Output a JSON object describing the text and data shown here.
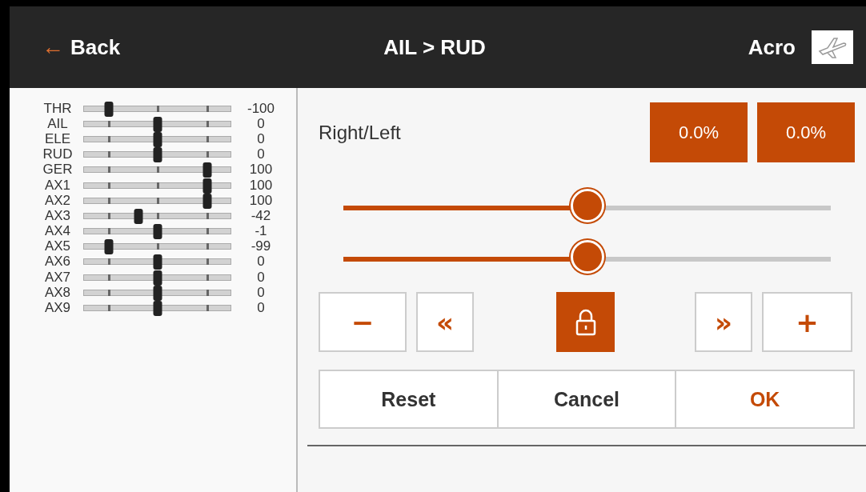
{
  "header": {
    "back": {
      "arrow": "←",
      "label": "Back"
    },
    "title": "AIL > RUD",
    "mode": "Acro"
  },
  "channels": [
    {
      "name": "THR",
      "level": 0.17,
      "reading": "-100"
    },
    {
      "name": "AIL",
      "level": 0.5,
      "reading": "0"
    },
    {
      "name": "ELE",
      "level": 0.5,
      "reading": "0"
    },
    {
      "name": "RUD",
      "level": 0.5,
      "reading": "0"
    },
    {
      "name": "GER",
      "level": 0.84,
      "reading": "100"
    },
    {
      "name": "AX1",
      "level": 0.84,
      "reading": "100"
    },
    {
      "name": "AX2",
      "level": 0.84,
      "reading": "100"
    },
    {
      "name": "AX3",
      "level": 0.37,
      "reading": "-42"
    },
    {
      "name": "AX4",
      "level": 0.5,
      "reading": "-1"
    },
    {
      "name": "AX5",
      "level": 0.17,
      "reading": "-99"
    },
    {
      "name": "AX6",
      "level": 0.5,
      "reading": "0"
    },
    {
      "name": "AX7",
      "level": 0.5,
      "reading": "0"
    },
    {
      "name": "AX8",
      "level": 0.5,
      "reading": "0"
    },
    {
      "name": "AX9",
      "level": 0.5,
      "reading": "0"
    }
  ],
  "editor": {
    "label": "Right/Left",
    "values": [
      "0.0%",
      "0.0%"
    ],
    "sliders": [
      {
        "level": 0.5
      },
      {
        "level": 0.5
      }
    ],
    "steppers": [
      {
        "kind": "minus",
        "label": "−"
      },
      {
        "kind": "fast-left",
        "label": "«"
      },
      {
        "kind": "lock"
      },
      {
        "kind": "fast-right",
        "label": "»"
      },
      {
        "kind": "plus",
        "label": "+"
      }
    ],
    "actions": [
      {
        "label": "Reset",
        "primary": false
      },
      {
        "label": "Cancel",
        "primary": false
      },
      {
        "label": "OK",
        "primary": true
      }
    ]
  }
}
